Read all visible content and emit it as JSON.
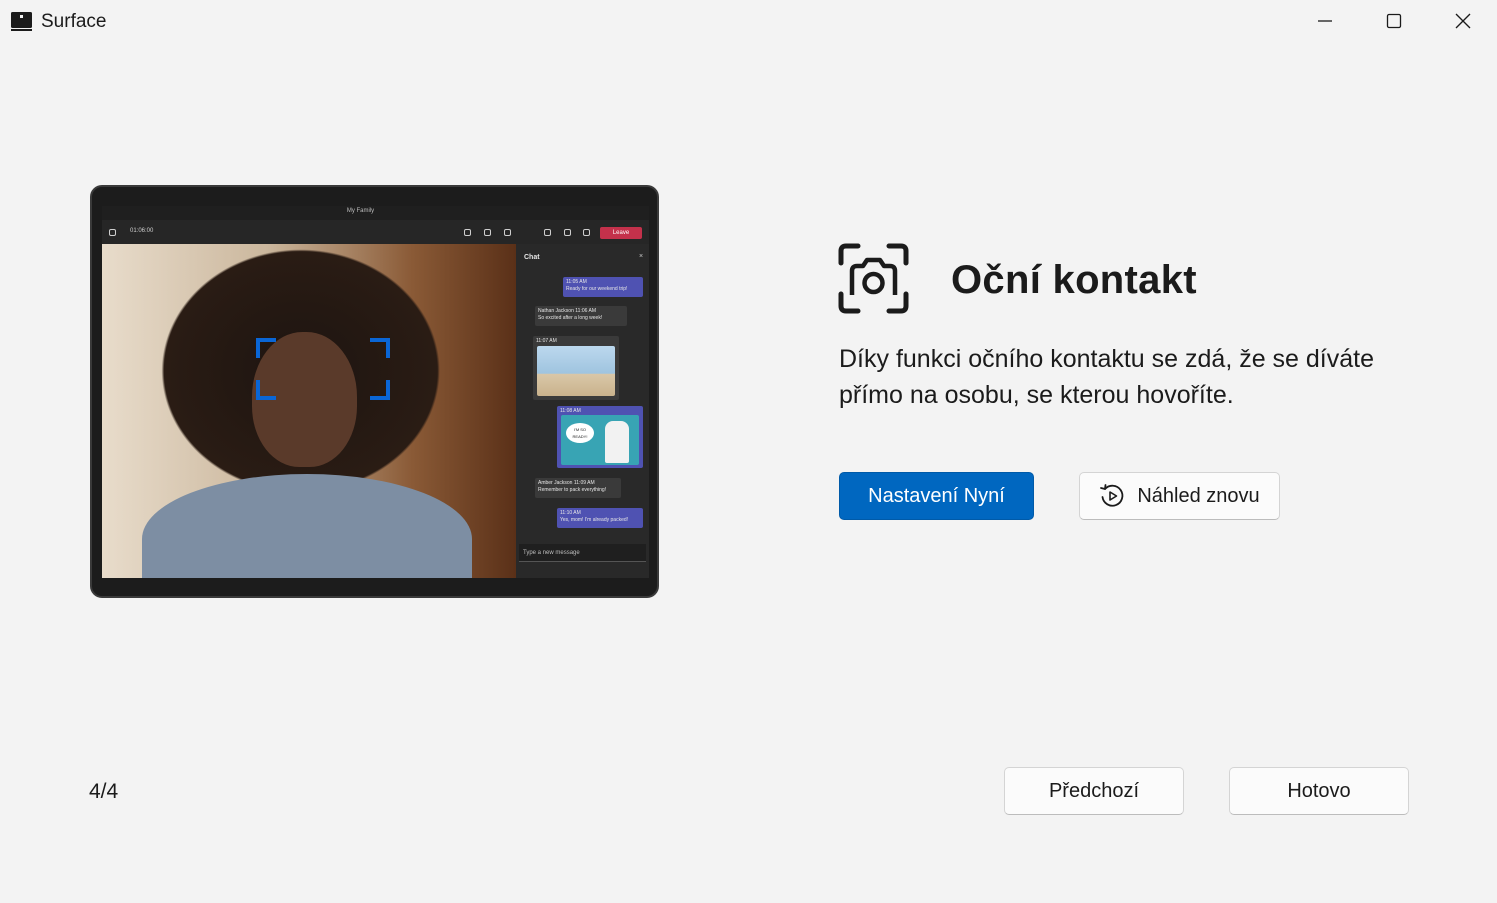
{
  "window": {
    "title": "Surface",
    "icon": "surface-app-icon"
  },
  "illustration": {
    "meeting_title": "My Family",
    "timer": "01:06:00",
    "leave_label": "Leave",
    "chat_title": "Chat",
    "chat_close": "×",
    "messages": [
      {
        "sender": "",
        "time": "11:05 AM",
        "text": "Ready for our weekend trip!"
      },
      {
        "sender": "Nathan Jackson",
        "time": "11:06 AM",
        "text": "So excited after a long week!"
      },
      {
        "sender": "",
        "time": "11:07 AM",
        "text": ""
      },
      {
        "sender": "",
        "time": "11:08 AM",
        "text": "I'M SO READY!"
      },
      {
        "sender": "Amber Jackson",
        "time": "11:09 AM",
        "text": "Remember to pack everything!"
      },
      {
        "sender": "",
        "time": "11:10 AM",
        "text": "Yes, mom! I'm already packed!"
      }
    ],
    "chat_input_placeholder": "Type a new message"
  },
  "feature": {
    "icon": "eye-contact-camera-icon",
    "title": "Oční kontakt",
    "description": "Díky funkci očního kontaktu se zdá, že se díváte přímo na osobu, se kterou hovoříte."
  },
  "actions": {
    "setup_now": "Nastavení Nyní",
    "replay_preview": "Náhled znovu"
  },
  "footer": {
    "page_counter": "4/4",
    "previous": "Předchozí",
    "done": "Hotovo"
  },
  "colors": {
    "accent": "#0067c0",
    "background": "#f3f3f3",
    "focus_box": "#0a66d6",
    "leave": "#c4314b"
  }
}
